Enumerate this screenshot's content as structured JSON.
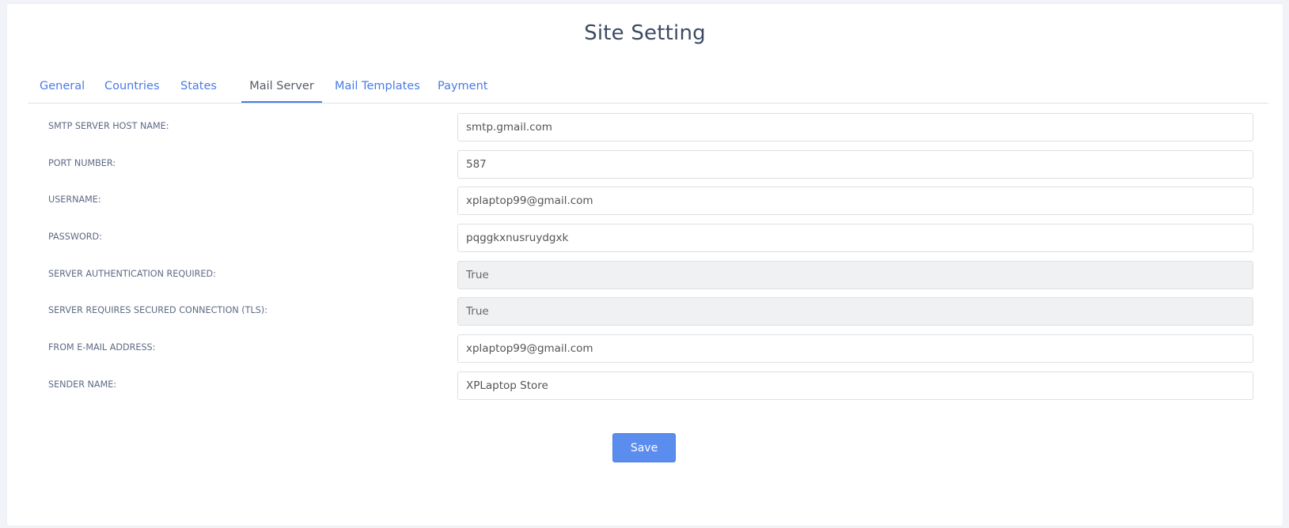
{
  "page": {
    "title": "Site Setting"
  },
  "tabs": [
    {
      "label": "General",
      "active": false
    },
    {
      "label": "Countries",
      "active": false
    },
    {
      "label": "States",
      "active": false
    },
    {
      "label": "Mail Server",
      "active": true
    },
    {
      "label": "Mail Templates",
      "active": false
    },
    {
      "label": "Payment",
      "active": false
    }
  ],
  "form": {
    "fields": [
      {
        "label": "SMTP SERVER HOST NAME:",
        "value": "smtp.gmail.com",
        "readonly": false
      },
      {
        "label": "PORT NUMBER:",
        "value": "587",
        "readonly": false
      },
      {
        "label": "USERNAME:",
        "value": "xplaptop99@gmail.com",
        "readonly": false
      },
      {
        "label": "PASSWORD:",
        "value": "pqggkxnusruydgxk",
        "readonly": false
      },
      {
        "label": "SERVER AUTHENTICATION REQUIRED:",
        "value": "True",
        "readonly": true
      },
      {
        "label": "SERVER REQUIRES SECURED CONNECTION (TLS):",
        "value": "True",
        "readonly": true
      },
      {
        "label": "FROM E-MAIL ADDRESS:",
        "value": "xplaptop99@gmail.com",
        "readonly": false
      },
      {
        "label": "SENDER NAME:",
        "value": "XPLaptop Store",
        "readonly": false
      }
    ],
    "save_label": "Save"
  },
  "colors": {
    "accent": "#4a7ae8",
    "button": "#5b8dee",
    "readonly_bg": "#f0f1f2"
  }
}
